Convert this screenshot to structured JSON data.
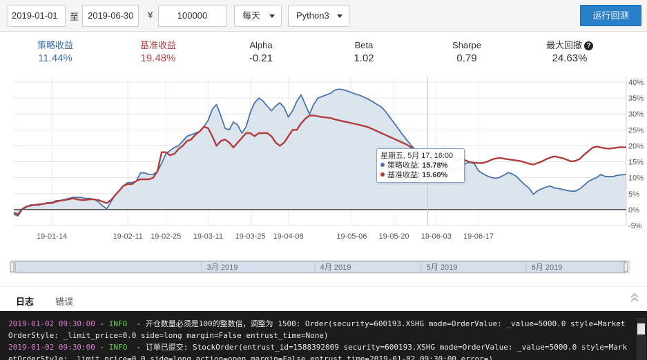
{
  "toolbar": {
    "start_date": "2019-01-01",
    "to_label": "至",
    "end_date": "2019-06-30",
    "currency_symbol": "¥",
    "capital": "100000",
    "frequency": "每天",
    "python_version": "Python3",
    "run_label": "运行回测"
  },
  "stats": {
    "strategy": {
      "label": "策略收益",
      "value": "11.44%"
    },
    "benchmark": {
      "label": "基准收益",
      "value": "19.48%"
    },
    "alpha": {
      "label": "Alpha",
      "value": "-0.21"
    },
    "beta": {
      "label": "Beta",
      "value": "1.02"
    },
    "sharpe": {
      "label": "Sharpe",
      "value": "0.79"
    },
    "max_drawdown": {
      "label": "最大回撤",
      "value": "24.63%"
    }
  },
  "colors": {
    "strategy": "#4a72ad",
    "benchmark": "#b03c3c",
    "area": "#d6dfeb",
    "run_button": "#2a7fc9"
  },
  "tooltip": {
    "title": "星期五, 5月 17, 16:00",
    "strategy_label": "策略收益: ",
    "strategy_value": "15.78%",
    "benchmark_label": "基准收益: ",
    "benchmark_value": "15.60%"
  },
  "chart_data": {
    "type": "line",
    "y_unit": "%",
    "ylim": [
      -5,
      40
    ],
    "y_ticks": [
      "40%",
      "35%",
      "30%",
      "25%",
      "20%",
      "15%",
      "10%",
      "5%",
      "0%",
      "-5%"
    ],
    "x_tick_labels": [
      "19-01-14",
      "19-02-11",
      "19-02-25",
      "19-03-11",
      "19-03-25",
      "19-04-08",
      "19-05-06",
      "19-05-20",
      "19-06-03",
      "19-06-17"
    ],
    "x_tick_index": [
      9,
      27,
      36,
      46,
      56,
      65,
      80,
      90,
      100,
      110
    ],
    "grid": true,
    "navigator_labels": [
      "3月 2019",
      "4月 2019",
      "5月 2019",
      "6月 2019"
    ],
    "series": [
      {
        "name": "策略收益",
        "values": [
          -1.5,
          -2,
          0,
          0.8,
          1.5,
          1.5,
          1.8,
          1.8,
          2.2,
          2.2,
          2.8,
          2.8,
          3.2,
          3.5,
          3.8,
          3.8,
          3.8,
          3.5,
          3.5,
          3.2,
          2.5,
          1.2,
          0.2,
          2.5,
          4.5,
          6,
          7.5,
          8.5,
          8.5,
          9,
          11.5,
          11.5,
          11,
          11,
          12,
          14.5,
          17.5,
          18.5,
          19.5,
          20,
          21.5,
          23,
          23.5,
          24,
          24.5,
          26,
          28,
          31.5,
          33,
          29.5,
          25.5,
          25,
          27.5,
          26.5,
          24,
          26,
          30.5,
          33.5,
          35,
          34,
          32.5,
          31,
          32.5,
          33.5,
          32,
          29,
          31,
          34,
          36,
          33,
          30,
          33,
          35,
          35.5,
          36,
          36.5,
          37.5,
          37.8,
          37.6,
          37.2,
          36.7,
          36.2,
          35.8,
          35.2,
          34.6,
          33.8,
          33,
          32.2,
          30.8,
          29,
          27.2,
          25.4,
          23.6,
          21.9,
          20.3,
          18.9,
          17.7,
          16.8,
          16.1,
          15.78,
          16.8,
          17.6,
          15.2,
          12.9,
          12.2,
          12.9,
          13.7,
          14.5,
          14.8,
          14.4,
          12.2,
          11.3,
          10.6,
          10.1,
          9.8,
          10.1,
          10.8,
          11.6,
          11.2,
          10.4,
          9,
          7.8,
          6.7,
          4.8,
          5.9,
          6.5,
          7.1,
          7.4,
          6.8,
          6.6,
          6.3,
          6,
          5.8,
          5.8,
          6.5,
          7.6,
          8.8,
          9.5,
          10.1,
          11,
          10.4,
          10.3,
          10.4,
          10.8,
          10.9,
          11
        ]
      },
      {
        "name": "基准收益",
        "values": [
          -1,
          -1.5,
          0.2,
          1,
          1.2,
          1.5,
          1.5,
          1.8,
          2,
          2,
          2.5,
          2.8,
          3,
          3.2,
          3.5,
          3.2,
          3,
          3,
          3.2,
          3.2,
          3,
          2.5,
          2,
          3,
          4.5,
          6,
          7.5,
          8,
          8,
          9,
          9.5,
          9.5,
          9.5,
          10,
          12,
          18,
          18,
          17,
          17.5,
          19,
          20,
          21.5,
          22,
          23.5,
          24.5,
          26,
          25.5,
          23,
          20,
          21.5,
          22,
          21,
          19.5,
          21,
          22.5,
          24,
          24,
          23,
          24,
          24,
          24,
          23,
          21,
          20,
          21,
          23,
          25,
          25,
          27,
          28.5,
          29.5,
          29.5,
          29.3,
          29,
          28.9,
          28.7,
          28.3,
          28,
          27.7,
          27.4,
          27.1,
          26.8,
          26.5,
          26.2,
          25.8,
          25.2,
          24.6,
          24,
          23.4,
          22.8,
          22.2,
          21.6,
          21,
          20.4,
          19.6,
          18.7,
          17.8,
          17,
          16.3,
          15.6,
          15.8,
          16.3,
          17.1,
          16.8,
          16.1,
          15.3,
          15.9,
          15.4,
          14.9,
          14.7,
          14.6,
          14.6,
          15,
          15.6,
          16,
          16.2,
          16,
          15.8,
          15.6,
          15.4,
          15.2,
          14.8,
          14.4,
          14.1,
          14.6,
          15.1,
          15.8,
          16.3,
          16.7,
          16.4,
          16.1,
          15.6,
          15.1,
          15.3,
          15.9,
          17.2,
          18.3,
          19.4,
          19.8,
          19.5,
          19.2,
          19.1,
          19.3,
          19.5,
          19.6,
          19.48
        ]
      }
    ],
    "hover_index": 98
  },
  "tabs": {
    "log": "日志",
    "error": "错误"
  },
  "console": {
    "lines": [
      {
        "time": "2019-01-02 09:30:00",
        "level": "INFO",
        "message": "开仓数量必须是100的整数倍，调整为 1500: Order(security=600193.XSHG mode=OrderValue: _value=5000.0 style=MarketOrderStyle: _limit_price=0.0 side=long margin=False entrust_time=None)"
      },
      {
        "time": "2019-01-02 09:30:00",
        "level": "INFO",
        "message": "订单已提交: StockOrder(entrust_id=1588392009 security=600193.XSHG mode=OrderValue: _value=5000.0 style=MarketOrderStyle: _limit_price=0.0 side=long action=open margin=False entrust_time=2019-01-02 09:30:00 error=)"
      }
    ]
  }
}
